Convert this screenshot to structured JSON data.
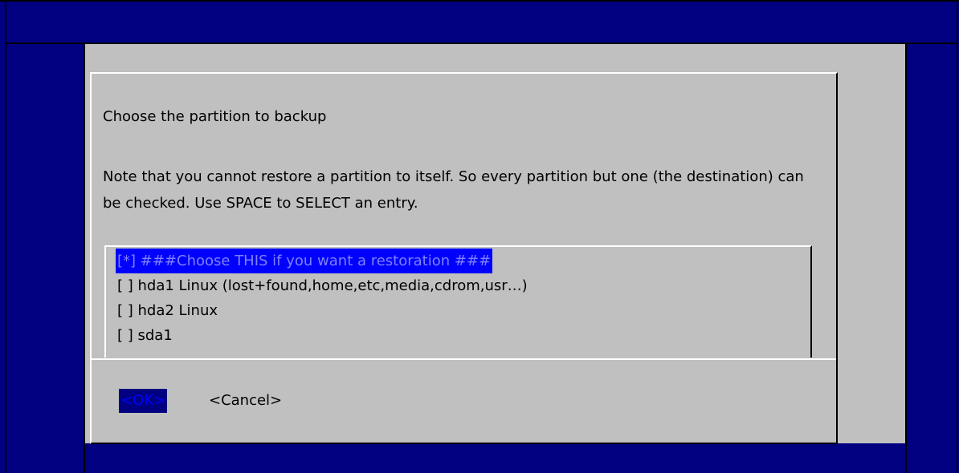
{
  "dialog": {
    "title": "Choose the partition to backup",
    "note": "Note that you cannot restore a partition to itself. So every partition but one (the destination) can be checked. Use SPACE to SELECT an entry."
  },
  "partitions": [
    {
      "label": "[*] ###Choose THIS if you want a restoration ###",
      "checked": true,
      "selected": true
    },
    {
      "label": "[ ] hda1 Linux (lost+found,home,etc,media,cdrom,usr…)",
      "checked": false,
      "selected": false
    },
    {
      "label": "[ ] hda2 Linux",
      "checked": false,
      "selected": false
    },
    {
      "label": "[ ] sda1",
      "checked": false,
      "selected": false
    }
  ],
  "buttons": {
    "ok": "<OK>",
    "cancel": "<Cancel>",
    "focused": "ok"
  },
  "colors": {
    "background": "#000080",
    "panel": "#c0c0c0",
    "highlight": "#0000ff",
    "highlight_text": "#8080ff"
  }
}
